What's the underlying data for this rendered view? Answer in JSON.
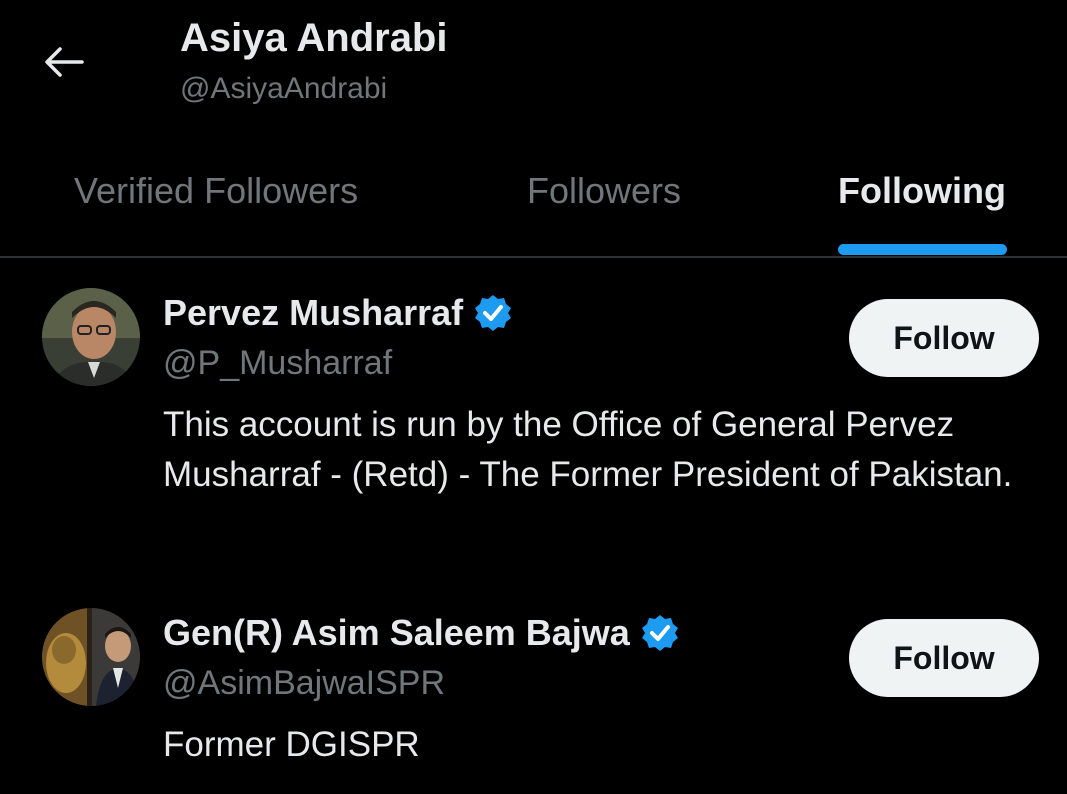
{
  "header": {
    "title": "Asiya Andrabi",
    "handle": "@AsiyaAndrabi",
    "back_icon": "arrow-left-icon"
  },
  "tabs": [
    {
      "label": "Verified Followers",
      "active": false
    },
    {
      "label": "Followers",
      "active": false
    },
    {
      "label": "Following",
      "active": true
    }
  ],
  "colors": {
    "background": "#000000",
    "accent": "#1d9bf0",
    "verified_badge": "#1d9bf0",
    "follow_button_bg": "#eff3f4",
    "muted_text": "#71767b"
  },
  "users": [
    {
      "name": "Pervez Musharraf",
      "verified": true,
      "handle": "@P_Musharraf",
      "bio": "This account is run by the Office of General Pervez Musharraf - (Retd) - The Former President of Pakistan.",
      "follow_label": "Follow"
    },
    {
      "name": "Gen(R) Asim Saleem Bajwa",
      "verified": true,
      "handle": "@AsimBajwaISPR",
      "bio": "Former DGISPR",
      "follow_label": "Follow"
    }
  ]
}
